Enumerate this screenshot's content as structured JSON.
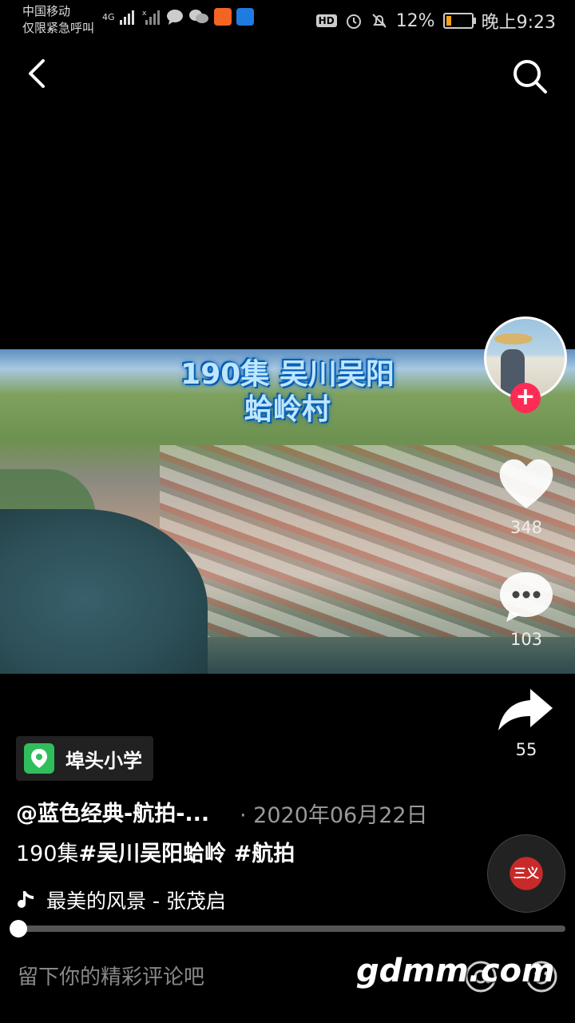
{
  "status_bar": {
    "carrier": "中国移动",
    "emergency": "仅限紧急呼叫",
    "network": "4G",
    "battery": "12%",
    "time": "晚上9:23",
    "hd": "HD"
  },
  "video": {
    "title_line1": "190集 吴川吴阳",
    "title_line2": "蛤岭村"
  },
  "actions": {
    "likes": "348",
    "comments": "103",
    "shares": "55"
  },
  "post": {
    "location": "埠头小学",
    "author": "@蓝色经典-航拍-...",
    "date": "· 2020年06月22日",
    "caption_prefix": "190集",
    "caption_tags": "#吴川吴阳蛤岭 #航拍",
    "music": "最美的风景 - 张茂启",
    "disc_label": "三义"
  },
  "progress": 0.0,
  "comment_box": {
    "placeholder": "留下你的精彩评论吧"
  },
  "watermark": "gdmm.com",
  "colors": {
    "accent": "#fe2c55",
    "location_pin": "#2fbe5b"
  }
}
